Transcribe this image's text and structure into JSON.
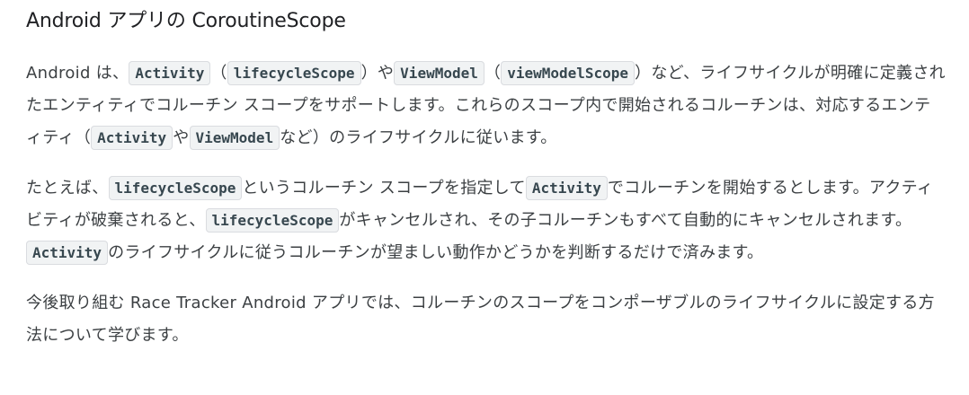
{
  "heading": "Android アプリの CoroutineScope",
  "p1": {
    "t1": "Android は、",
    "c1": "Activity",
    "t2": "（",
    "c2": "lifecycleScope",
    "t3": "）や",
    "c3": "ViewModel",
    "t4": "（",
    "c4": "viewModelScope",
    "t5": "）など、ライフサイクルが明確に定義されたエンティティでコルーチン スコープをサポートします。これらのスコープ内で開始されるコルーチンは、対応するエンティティ（",
    "c5": "Activity",
    "t6": "や",
    "c6": "ViewModel",
    "t7": "など）のライフサイクルに従います。"
  },
  "p2": {
    "t1": "たとえば、",
    "c1": "lifecycleScope",
    "t2": "というコルーチン スコープを指定して",
    "c2": "Activity",
    "t3": "でコルーチンを開始するとします。アクティビティが破棄されると、",
    "c3": "lifecycleScope",
    "t4": "がキャンセルされ、その子コルーチンもすべて自動的にキャンセルされます。",
    "c4": "Activity",
    "t5": "のライフサイクルに従うコルーチンが望ましい動作かどうかを判断するだけで済みます。"
  },
  "p3": {
    "t1": "今後取り組む Race Tracker Android アプリでは、コルーチンのスコープをコンポーザブルのライフサイクルに設定する方法について学びます。"
  }
}
